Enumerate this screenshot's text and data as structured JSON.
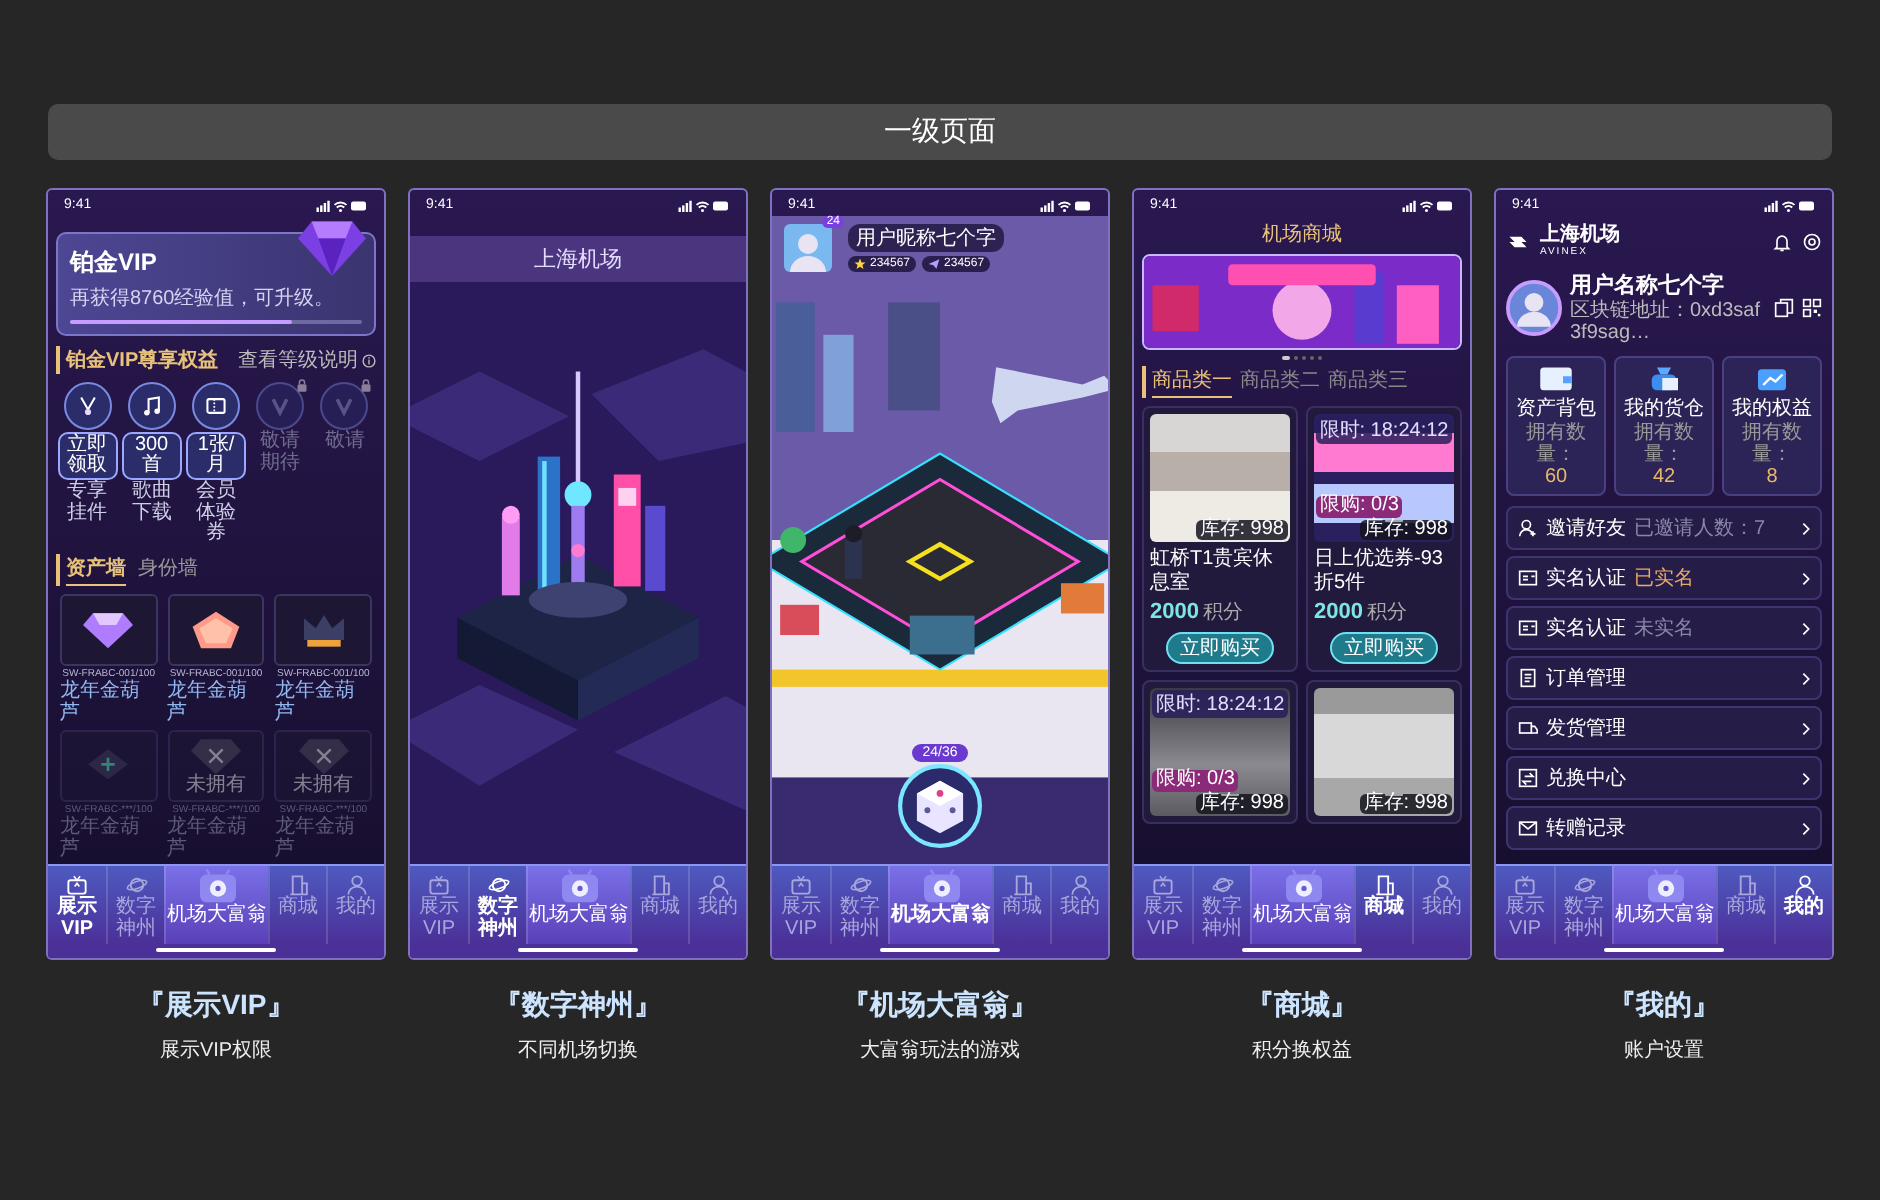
{
  "page_title": "一级页面",
  "screens": [
    {
      "kind": "vip",
      "time": "9:41",
      "vip_card": {
        "title": "铂金VIP",
        "subtitle": "再获得8760经验值，可升级。",
        "level": 0.76
      },
      "benefits_title": "铂金VIP尊享权益",
      "benefits_link": "查看等级说明",
      "benefits": [
        {
          "badge": "立即领取",
          "label": "专享挂件",
          "locked": false
        },
        {
          "badge": "300首",
          "label": "歌曲下载",
          "locked": false
        },
        {
          "badge": "1张/月",
          "label": "会员体验券",
          "locked": false
        },
        {
          "label": "敬请期待",
          "locked": true
        },
        {
          "label": "敬请",
          "locked": true
        }
      ],
      "wall_tabs": [
        {
          "label": "资产墙",
          "selected": true
        },
        {
          "label": "身份墙",
          "selected": false
        }
      ],
      "assets": [
        {
          "code": "SW-FRABC-001/100",
          "name": "龙年金葫芦",
          "owned": true
        },
        {
          "code": "SW-FRABC-001/100",
          "name": "龙年金葫芦",
          "owned": true
        },
        {
          "code": "SW-FRABC-001/100",
          "name": "龙年金葫芦",
          "owned": true
        },
        {
          "code": "SW-FRABC-***/100",
          "name": "龙年金葫芦",
          "owned": false
        },
        {
          "code": "SW-FRABC-***/100",
          "name": "龙年金葫芦",
          "owned": false,
          "tag": "未拥有"
        },
        {
          "code": "SW-FRABC-***/100",
          "name": "龙年金葫芦",
          "owned": false,
          "tag": "未拥有"
        }
      ],
      "tabbar": [
        {
          "label": "展示VIP",
          "selected": true,
          "kind": "normal"
        },
        {
          "label": "数字神州",
          "selected": false,
          "kind": "normal"
        },
        {
          "label": "机场大富翁",
          "selected": false,
          "kind": "center"
        },
        {
          "label": "商城",
          "selected": false,
          "kind": "normal"
        },
        {
          "label": "我的",
          "selected": false,
          "kind": "normal"
        }
      ],
      "caption": "『展示VIP』",
      "subcaption": "展示VIP权限"
    },
    {
      "kind": "city",
      "time": "9:41",
      "title": "上海机场",
      "tabbar": [
        {
          "label": "展示VIP",
          "selected": false,
          "kind": "normal"
        },
        {
          "label": "数字神州",
          "selected": true,
          "kind": "normal"
        },
        {
          "label": "机场大富翁",
          "selected": false,
          "kind": "center"
        },
        {
          "label": "商城",
          "selected": false,
          "kind": "normal"
        },
        {
          "label": "我的",
          "selected": false,
          "kind": "normal"
        }
      ],
      "caption": "『数字神州』",
      "subcaption": "不同机场切换"
    },
    {
      "kind": "game",
      "time": "9:41",
      "player": {
        "rank": "24",
        "name": "用户昵称七个字",
        "star_count": "234567",
        "plane_count": "234567"
      },
      "dice_count": "24/36",
      "tabbar": [
        {
          "label": "展示VIP",
          "selected": false,
          "kind": "normal"
        },
        {
          "label": "数字神州",
          "selected": false,
          "kind": "normal"
        },
        {
          "label": "机场大富翁",
          "selected": true,
          "kind": "center"
        },
        {
          "label": "商城",
          "selected": false,
          "kind": "normal"
        },
        {
          "label": "我的",
          "selected": false,
          "kind": "normal"
        }
      ],
      "caption": "『机场大富翁』",
      "subcaption": "大富翁玩法的游戏"
    },
    {
      "kind": "shop",
      "time": "9:41",
      "title": "机场商城",
      "banner_dots": [
        {
          "selected": true
        },
        {
          "selected": false
        },
        {
          "selected": false
        },
        {
          "selected": false
        },
        {
          "selected": false
        }
      ],
      "categories": [
        {
          "label": "商品类一",
          "selected": true
        },
        {
          "label": "商品类二",
          "selected": false
        },
        {
          "label": "商品类三",
          "selected": false
        }
      ],
      "products": [
        {
          "stock": "库存: 998",
          "name": "虹桥T1贵宾休息室",
          "price": "2000",
          "unit": "积分",
          "button": "立即购买"
        },
        {
          "timer": "限时: 18:24:12",
          "quota": "限购: 0/3",
          "stock": "库存: 998",
          "name": "日上优选券-93折5件",
          "price": "2000",
          "unit": "积分",
          "button": "立即购买"
        },
        {
          "timer": "限时: 18:24:12",
          "quota": "限购: 0/3",
          "stock": "库存: 998"
        },
        {
          "stock": "库存: 998"
        }
      ],
      "tabbar": [
        {
          "label": "展示VIP",
          "selected": false,
          "kind": "normal"
        },
        {
          "label": "数字神州",
          "selected": false,
          "kind": "normal"
        },
        {
          "label": "机场大富翁",
          "selected": false,
          "kind": "center"
        },
        {
          "label": "商城",
          "selected": true,
          "kind": "normal"
        },
        {
          "label": "我的",
          "selected": false,
          "kind": "normal"
        }
      ],
      "caption": "『商城』",
      "subcaption": "积分换权益"
    },
    {
      "kind": "profile",
      "time": "9:41",
      "brand": {
        "name": "上海机场",
        "sub": "AVINEX"
      },
      "user": {
        "name": "用户名称七个字",
        "address": "区块链地址：0xd3saf3f9sag…"
      },
      "cards": [
        {
          "title": "资产背包",
          "count_label": "拥有数量：",
          "count": "60"
        },
        {
          "title": "我的货仓",
          "count_label": "拥有数量：",
          "count": "42"
        },
        {
          "title": "我的权益",
          "count_label": "拥有数量：",
          "count": "8"
        }
      ],
      "menu": [
        {
          "label": "邀请好友",
          "note": "已邀请人数：7",
          "accent": false
        },
        {
          "label": "实名认证",
          "note": "已实名",
          "accent": true
        },
        {
          "label": "实名认证",
          "note": "未实名",
          "accent": false
        },
        {
          "label": "订单管理"
        },
        {
          "label": "发货管理"
        },
        {
          "label": "兑换中心"
        },
        {
          "label": "转赠记录"
        }
      ],
      "tabbar": [
        {
          "label": "展示VIP",
          "selected": false,
          "kind": "normal"
        },
        {
          "label": "数字神州",
          "selected": false,
          "kind": "normal"
        },
        {
          "label": "机场大富翁",
          "selected": false,
          "kind": "center"
        },
        {
          "label": "商城",
          "selected": false,
          "kind": "normal"
        },
        {
          "label": "我的",
          "selected": true,
          "kind": "normal"
        }
      ],
      "caption": "『我的』",
      "subcaption": "账户设置"
    }
  ]
}
